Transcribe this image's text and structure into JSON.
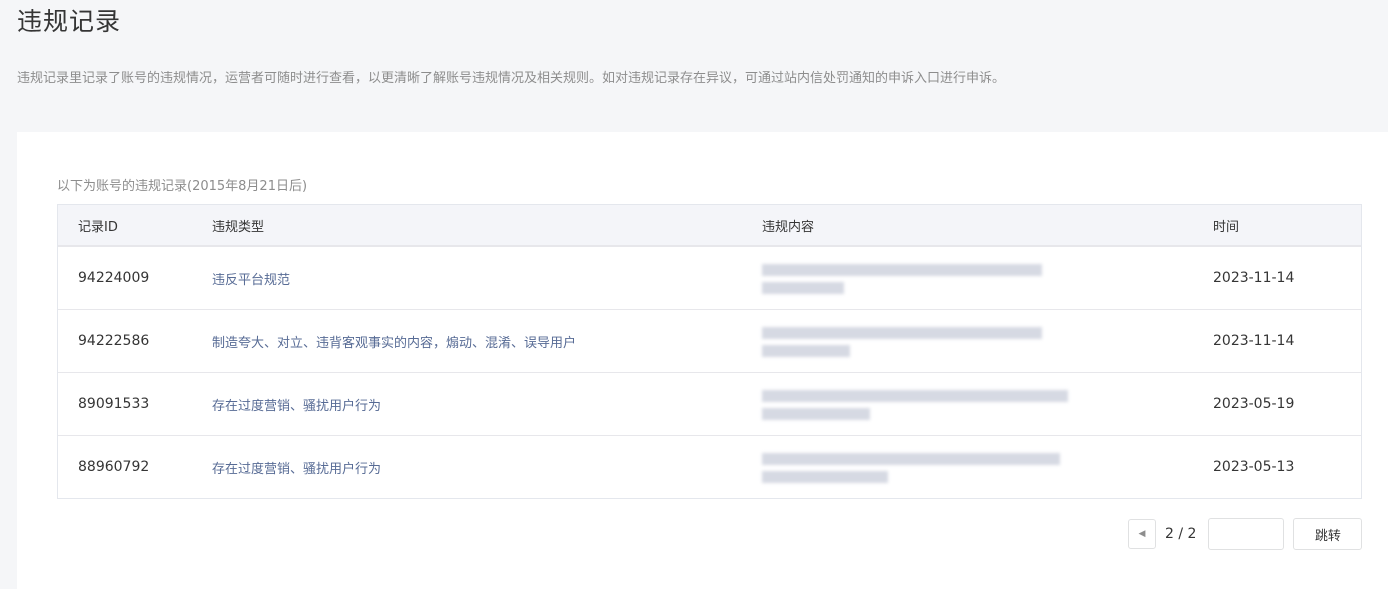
{
  "page": {
    "title": "违规记录",
    "description": "违规记录里记录了账号的违规情况，运营者可随时进行查看，以更清晰了解账号违规情况及相关规则。如对违规记录存在异议，可通过站内信处罚通知的申诉入口进行申诉。"
  },
  "records": {
    "caption": "以下为账号的违规记录(2015年8月21日后)",
    "columns": {
      "id": "记录ID",
      "type": "违规类型",
      "content": "违规内容",
      "time": "时间"
    },
    "rows": [
      {
        "id": "94224009",
        "type": "违反平台规范",
        "time": "2023-11-14"
      },
      {
        "id": "94222586",
        "type": "制造夸大、对立、违背客观事实的内容，煽动、混淆、误导用户",
        "time": "2023-11-14"
      },
      {
        "id": "89091533",
        "type": "存在过度营销、骚扰用户行为",
        "time": "2023-05-19"
      },
      {
        "id": "88960792",
        "type": "存在过度营销、骚扰用户行为",
        "time": "2023-05-13"
      }
    ]
  },
  "pagination": {
    "prev_icon": "triangle-left-icon",
    "page_status": "2 / 2",
    "page_input_value": "",
    "jump_label": "跳转"
  }
}
